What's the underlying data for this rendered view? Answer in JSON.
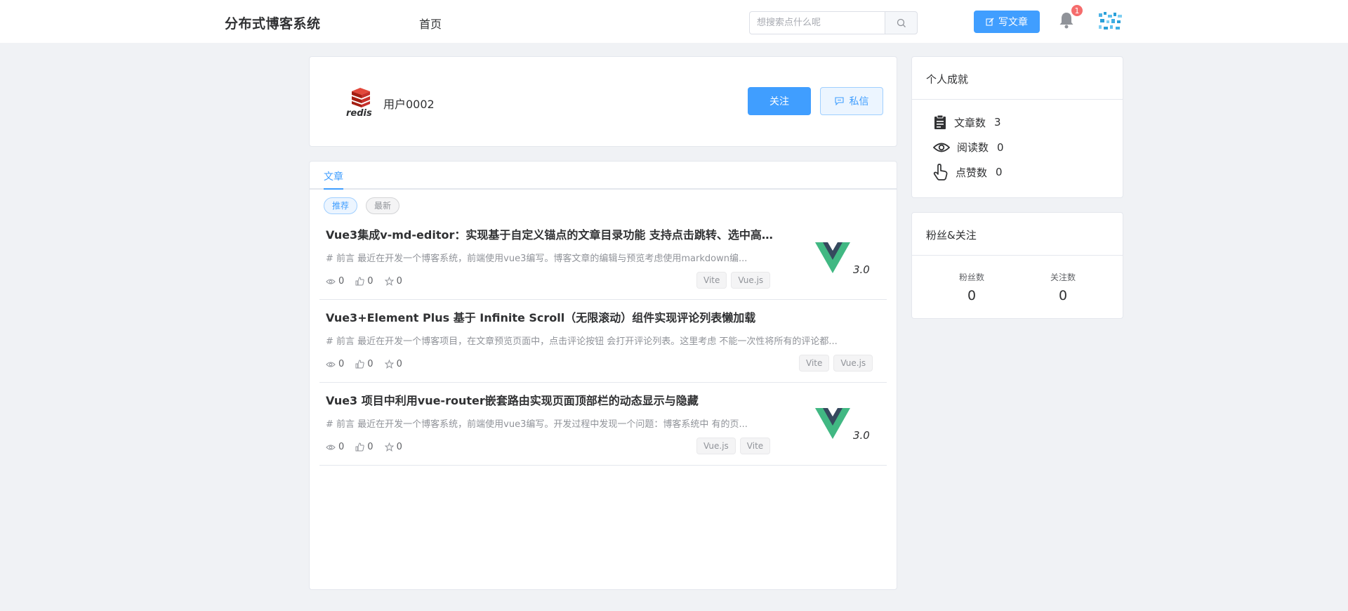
{
  "header": {
    "logo": "分布式博客系统",
    "nav_home": "首页",
    "search_placeholder": "想搜索点什么呢",
    "write_label": "写文章",
    "notification_count": "1"
  },
  "profile": {
    "username": "用户0002",
    "follow_label": "关注",
    "message_label": "私信"
  },
  "articles": {
    "tab": "文章",
    "filters": [
      "推荐",
      "最新"
    ],
    "items": [
      {
        "title": "Vue3集成v-md-editor：实现基于自定义锚点的文章目录功能 支持点击跳转、选中高亮...",
        "summary": "# 前言 最近在开发一个博客系统，前端使用vue3编写。博客文章的编辑与预览考虑使用markdown编...",
        "views": "0",
        "likes": "0",
        "stars": "0",
        "tags": [
          "Vite",
          "Vue.js"
        ],
        "has_thumb": true
      },
      {
        "title": "Vue3+Element Plus 基于 Infinite Scroll（无限滚动）组件实现评论列表懒加载",
        "summary": "# 前言 最近在开发一个博客项目，在文章预览页面中，点击评论按钮 会打开评论列表。这里考虑 不能一次性将所有的评论都...",
        "views": "0",
        "likes": "0",
        "stars": "0",
        "tags": [
          "Vite",
          "Vue.js"
        ],
        "has_thumb": false
      },
      {
        "title": "Vue3 项目中利用vue-router嵌套路由实现页面顶部栏的动态显示与隐藏",
        "summary": "# 前言 最近在开发一个博客系统，前端使用vue3编写。开发过程中发现一个问题：博客系统中 有的页...",
        "views": "0",
        "likes": "0",
        "stars": "0",
        "tags": [
          "Vue.js",
          "Vite"
        ],
        "has_thumb": true
      }
    ],
    "thumb_text": "3.0"
  },
  "achievements": {
    "title": "个人成就",
    "rows": [
      {
        "label": "文章数",
        "value": "3",
        "icon": "clipboard-icon"
      },
      {
        "label": "阅读数",
        "value": "0",
        "icon": "eye-icon"
      },
      {
        "label": "点赞数",
        "value": "0",
        "icon": "pointer-icon"
      }
    ]
  },
  "fans": {
    "title": "粉丝&关注",
    "fans_label": "粉丝数",
    "fans_value": "0",
    "following_label": "关注数",
    "following_value": "0"
  },
  "colors": {
    "primary": "#409eff",
    "badge": "#f56c6c",
    "vue_green": "#41b883",
    "vue_dark": "#35495e",
    "redis_red": "#d82c20"
  }
}
